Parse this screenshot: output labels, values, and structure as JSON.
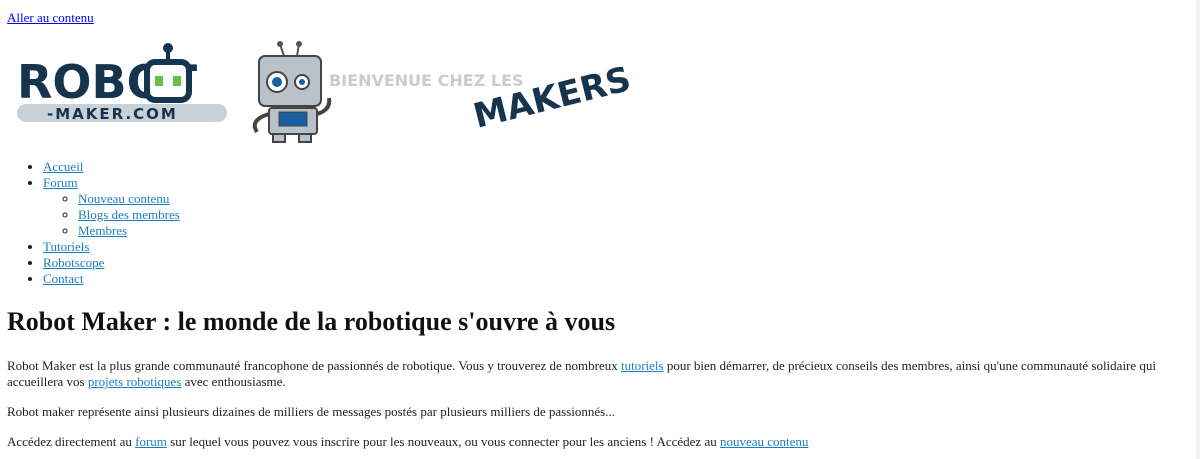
{
  "skip_link": "Aller au contenu",
  "banner": {
    "logo_word": "ROBOT",
    "logo_sub": "-MAKER.COM",
    "welcome": "BIENVENUE CHEZ LES",
    "makers": "MAKERS !",
    "colors": {
      "navy": "#17344f",
      "green": "#6abf4b",
      "gray": "#c8d1d8",
      "robot": "#b9c2c9"
    }
  },
  "nav": {
    "items": [
      {
        "label": "Accueil"
      },
      {
        "label": "Forum",
        "children": [
          {
            "label": "Nouveau contenu"
          },
          {
            "label": "Blogs des membres"
          },
          {
            "label": "Membres"
          }
        ]
      },
      {
        "label": "Tutoriels"
      },
      {
        "label": "Robotscope"
      },
      {
        "label": "Contact"
      }
    ]
  },
  "main": {
    "title": "Robot Maker : le monde de la robotique s'ouvre à vous",
    "p1": {
      "t1": "Robot Maker est la plus grande communauté francophone de passionnés de robotique. Vous y trouverez de nombreux ",
      "link1": "tutoriels",
      "t2": " pour bien démarrer, de précieux conseils des membres, ainsi qu'une communauté solidaire qui accueillera vos ",
      "link2": "projets robotiques",
      "t3": " avec enthousiasme."
    },
    "p2": "Robot maker représente ainsi plusieurs dizaines de milliers de messages postés par plusieurs milliers de passionnés...",
    "p3": {
      "t1": "Accédez directement au ",
      "link1": "forum",
      "t2": " sur lequel vous pouvez vous inscrire pour les nouveaux, ou vous connecter pour les anciens ! Accédez au ",
      "link2": "nouveau contenu"
    }
  }
}
